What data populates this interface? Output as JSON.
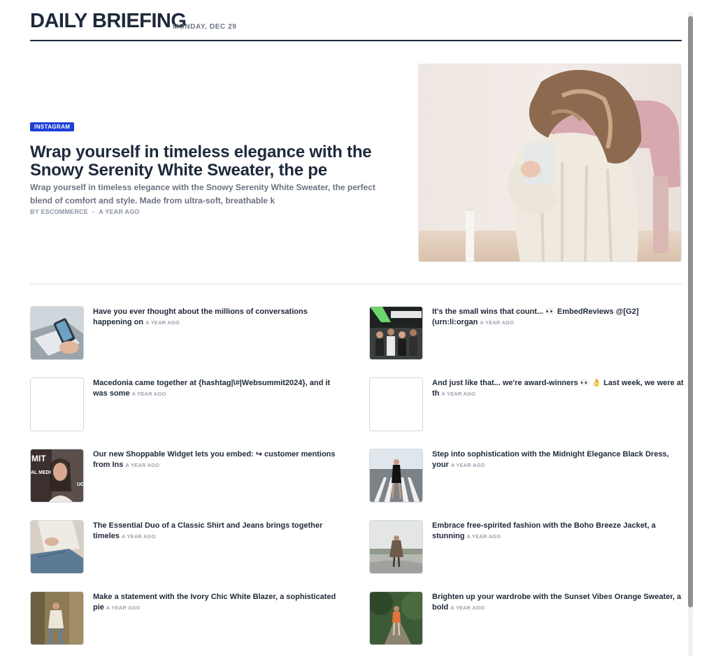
{
  "header": {
    "brand": "DAILY BRIEFING",
    "date": "MONDAY, DEC 29"
  },
  "hero": {
    "badge": "INSTAGRAM",
    "title": "Wrap yourself in timeless elegance with the Snowy Serenity White Sweater, the pe",
    "summary": "Wrap yourself in timeless elegance with the Snowy Serenity White Sweater, the perfect blend of comfort and style. Made from ultra-soft, breathable k",
    "author": "BY ESCOMMERCE",
    "time": "A YEAR AGO",
    "image": "woman-white-sweater-photo"
  },
  "items": [
    {
      "text": "Have you ever thought about the millions of conversations happening on",
      "time": "A YEAR AGO",
      "thumb": "phone-laptop-photo"
    },
    {
      "text": "It's the small wins that count... 👀 EmbedReviews @[G2] (urn:li:organ",
      "time": "A YEAR AGO",
      "thumb": "team-group-photo"
    },
    {
      "text": "Macedonia came together at {hashtag|\\#|Websummit2024}, and it was some",
      "time": "A YEAR AGO",
      "thumb": "empty"
    },
    {
      "text": "And just like that... we're award-winners 👀 👌 Last week, we were at th",
      "time": "A YEAR AGO",
      "thumb": "empty"
    },
    {
      "text": "Our new Shoppable Widget lets you embed: ↪ customer mentions from Ins",
      "time": "A YEAR AGO",
      "thumb": "woman-video-photo"
    },
    {
      "text": "Step into sophistication with the Midnight Elegance Black Dress, your",
      "time": "A YEAR AGO",
      "thumb": "black-dress-street-photo"
    },
    {
      "text": "The Essential Duo of a Classic Shirt and Jeans brings together timeles",
      "time": "A YEAR AGO",
      "thumb": "shirt-jeans-photo"
    },
    {
      "text": "Embrace free-spirited fashion with the Boho Breeze Jacket, a stunning",
      "time": "A YEAR AGO",
      "thumb": "boho-jacket-photo"
    },
    {
      "text": "Make a statement with the Ivory Chic White Blazer, a sophisticated pie",
      "time": "A YEAR AGO",
      "thumb": "white-blazer-photo"
    },
    {
      "text": "Brighten up your wardrobe with the Sunset Vibes Orange Sweater, a bold",
      "time": "A YEAR AGO",
      "thumb": "orange-sweater-photo"
    }
  ]
}
